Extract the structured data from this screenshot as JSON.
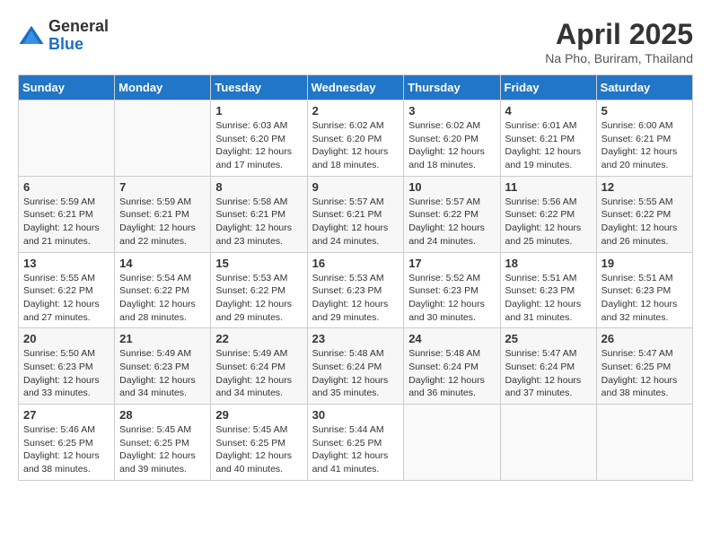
{
  "logo": {
    "general": "General",
    "blue": "Blue"
  },
  "title": "April 2025",
  "location": "Na Pho, Buriram, Thailand",
  "days_of_week": [
    "Sunday",
    "Monday",
    "Tuesday",
    "Wednesday",
    "Thursday",
    "Friday",
    "Saturday"
  ],
  "weeks": [
    [
      {
        "day": "",
        "sunrise": "",
        "sunset": "",
        "daylight": ""
      },
      {
        "day": "",
        "sunrise": "",
        "sunset": "",
        "daylight": ""
      },
      {
        "day": "1",
        "sunrise": "Sunrise: 6:03 AM",
        "sunset": "Sunset: 6:20 PM",
        "daylight": "Daylight: 12 hours and 17 minutes."
      },
      {
        "day": "2",
        "sunrise": "Sunrise: 6:02 AM",
        "sunset": "Sunset: 6:20 PM",
        "daylight": "Daylight: 12 hours and 18 minutes."
      },
      {
        "day": "3",
        "sunrise": "Sunrise: 6:02 AM",
        "sunset": "Sunset: 6:20 PM",
        "daylight": "Daylight: 12 hours and 18 minutes."
      },
      {
        "day": "4",
        "sunrise": "Sunrise: 6:01 AM",
        "sunset": "Sunset: 6:21 PM",
        "daylight": "Daylight: 12 hours and 19 minutes."
      },
      {
        "day": "5",
        "sunrise": "Sunrise: 6:00 AM",
        "sunset": "Sunset: 6:21 PM",
        "daylight": "Daylight: 12 hours and 20 minutes."
      }
    ],
    [
      {
        "day": "6",
        "sunrise": "Sunrise: 5:59 AM",
        "sunset": "Sunset: 6:21 PM",
        "daylight": "Daylight: 12 hours and 21 minutes."
      },
      {
        "day": "7",
        "sunrise": "Sunrise: 5:59 AM",
        "sunset": "Sunset: 6:21 PM",
        "daylight": "Daylight: 12 hours and 22 minutes."
      },
      {
        "day": "8",
        "sunrise": "Sunrise: 5:58 AM",
        "sunset": "Sunset: 6:21 PM",
        "daylight": "Daylight: 12 hours and 23 minutes."
      },
      {
        "day": "9",
        "sunrise": "Sunrise: 5:57 AM",
        "sunset": "Sunset: 6:21 PM",
        "daylight": "Daylight: 12 hours and 24 minutes."
      },
      {
        "day": "10",
        "sunrise": "Sunrise: 5:57 AM",
        "sunset": "Sunset: 6:22 PM",
        "daylight": "Daylight: 12 hours and 24 minutes."
      },
      {
        "day": "11",
        "sunrise": "Sunrise: 5:56 AM",
        "sunset": "Sunset: 6:22 PM",
        "daylight": "Daylight: 12 hours and 25 minutes."
      },
      {
        "day": "12",
        "sunrise": "Sunrise: 5:55 AM",
        "sunset": "Sunset: 6:22 PM",
        "daylight": "Daylight: 12 hours and 26 minutes."
      }
    ],
    [
      {
        "day": "13",
        "sunrise": "Sunrise: 5:55 AM",
        "sunset": "Sunset: 6:22 PM",
        "daylight": "Daylight: 12 hours and 27 minutes."
      },
      {
        "day": "14",
        "sunrise": "Sunrise: 5:54 AM",
        "sunset": "Sunset: 6:22 PM",
        "daylight": "Daylight: 12 hours and 28 minutes."
      },
      {
        "day": "15",
        "sunrise": "Sunrise: 5:53 AM",
        "sunset": "Sunset: 6:22 PM",
        "daylight": "Daylight: 12 hours and 29 minutes."
      },
      {
        "day": "16",
        "sunrise": "Sunrise: 5:53 AM",
        "sunset": "Sunset: 6:23 PM",
        "daylight": "Daylight: 12 hours and 29 minutes."
      },
      {
        "day": "17",
        "sunrise": "Sunrise: 5:52 AM",
        "sunset": "Sunset: 6:23 PM",
        "daylight": "Daylight: 12 hours and 30 minutes."
      },
      {
        "day": "18",
        "sunrise": "Sunrise: 5:51 AM",
        "sunset": "Sunset: 6:23 PM",
        "daylight": "Daylight: 12 hours and 31 minutes."
      },
      {
        "day": "19",
        "sunrise": "Sunrise: 5:51 AM",
        "sunset": "Sunset: 6:23 PM",
        "daylight": "Daylight: 12 hours and 32 minutes."
      }
    ],
    [
      {
        "day": "20",
        "sunrise": "Sunrise: 5:50 AM",
        "sunset": "Sunset: 6:23 PM",
        "daylight": "Daylight: 12 hours and 33 minutes."
      },
      {
        "day": "21",
        "sunrise": "Sunrise: 5:49 AM",
        "sunset": "Sunset: 6:23 PM",
        "daylight": "Daylight: 12 hours and 34 minutes."
      },
      {
        "day": "22",
        "sunrise": "Sunrise: 5:49 AM",
        "sunset": "Sunset: 6:24 PM",
        "daylight": "Daylight: 12 hours and 34 minutes."
      },
      {
        "day": "23",
        "sunrise": "Sunrise: 5:48 AM",
        "sunset": "Sunset: 6:24 PM",
        "daylight": "Daylight: 12 hours and 35 minutes."
      },
      {
        "day": "24",
        "sunrise": "Sunrise: 5:48 AM",
        "sunset": "Sunset: 6:24 PM",
        "daylight": "Daylight: 12 hours and 36 minutes."
      },
      {
        "day": "25",
        "sunrise": "Sunrise: 5:47 AM",
        "sunset": "Sunset: 6:24 PM",
        "daylight": "Daylight: 12 hours and 37 minutes."
      },
      {
        "day": "26",
        "sunrise": "Sunrise: 5:47 AM",
        "sunset": "Sunset: 6:25 PM",
        "daylight": "Daylight: 12 hours and 38 minutes."
      }
    ],
    [
      {
        "day": "27",
        "sunrise": "Sunrise: 5:46 AM",
        "sunset": "Sunset: 6:25 PM",
        "daylight": "Daylight: 12 hours and 38 minutes."
      },
      {
        "day": "28",
        "sunrise": "Sunrise: 5:45 AM",
        "sunset": "Sunset: 6:25 PM",
        "daylight": "Daylight: 12 hours and 39 minutes."
      },
      {
        "day": "29",
        "sunrise": "Sunrise: 5:45 AM",
        "sunset": "Sunset: 6:25 PM",
        "daylight": "Daylight: 12 hours and 40 minutes."
      },
      {
        "day": "30",
        "sunrise": "Sunrise: 5:44 AM",
        "sunset": "Sunset: 6:25 PM",
        "daylight": "Daylight: 12 hours and 41 minutes."
      },
      {
        "day": "",
        "sunrise": "",
        "sunset": "",
        "daylight": ""
      },
      {
        "day": "",
        "sunrise": "",
        "sunset": "",
        "daylight": ""
      },
      {
        "day": "",
        "sunrise": "",
        "sunset": "",
        "daylight": ""
      }
    ]
  ]
}
